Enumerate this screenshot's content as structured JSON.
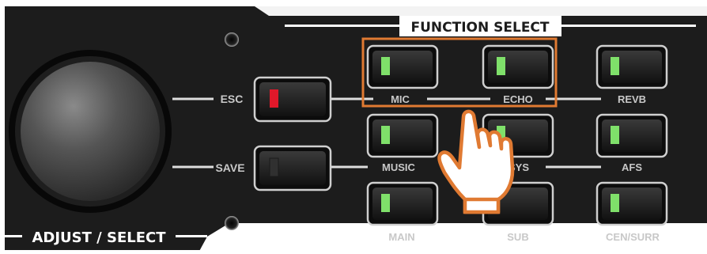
{
  "panel": {
    "function_select_title": "FUNCTION SELECT",
    "adjust_select_title": "ADJUST / SELECT"
  },
  "controls": {
    "esc_label": "ESC",
    "save_label": "SAVE",
    "esc_led": "red",
    "save_led": "off"
  },
  "function_buttons": [
    {
      "label": "MIC",
      "led": "green",
      "highlighted": true
    },
    {
      "label": "ECHO",
      "led": "green",
      "highlighted": true
    },
    {
      "label": "REVB",
      "led": "green"
    },
    {
      "label": "MUSIC",
      "led": "green"
    },
    {
      "label": "SYS",
      "led": "green"
    },
    {
      "label": "AFS",
      "led": "green"
    },
    {
      "label": "MAIN",
      "led": "green"
    },
    {
      "label": "SUB",
      "led": "green"
    },
    {
      "label": "CEN/SURR",
      "led": "green"
    }
  ],
  "colors": {
    "panel": "#1c1c1c",
    "accent_orange": "#e07a32",
    "led_green": "#7fe06a",
    "led_red": "#e0182a",
    "label_gray": "#c8c8c8"
  },
  "icons": {
    "pointer": "hand-pointer-icon",
    "knob": "rotary-knob"
  }
}
